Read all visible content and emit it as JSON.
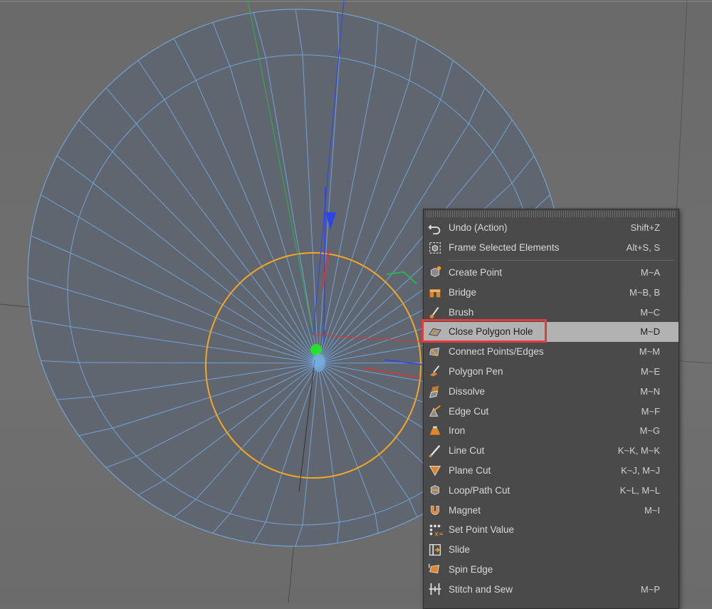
{
  "viewport": {
    "colors": {
      "mesh_fill": "#5f6670",
      "wire": "#6fa3d8",
      "selection": "#f5a623",
      "axis_x": "#e0342c",
      "axis_y": "#2bb34a",
      "axis_z": "#2f44e8",
      "pivot": "#27e02b"
    }
  },
  "context_menu": {
    "items": [
      {
        "label": "Undo (Action)",
        "shortcut": "Shift+Z",
        "icon": "undo-icon"
      },
      {
        "label": "Frame Selected Elements",
        "shortcut": "Alt+S, S",
        "icon": "frame-selected-icon"
      },
      {
        "label": "Create Point",
        "shortcut": "M~A",
        "icon": "create-point-icon"
      },
      {
        "label": "Bridge",
        "shortcut": "M~B, B",
        "icon": "bridge-icon"
      },
      {
        "label": "Brush",
        "shortcut": "M~C",
        "icon": "brush-icon"
      },
      {
        "label": "Close Polygon Hole",
        "shortcut": "M~D",
        "icon": "close-polygon-hole-icon"
      },
      {
        "label": "Connect Points/Edges",
        "shortcut": "M~M",
        "icon": "connect-points-icon"
      },
      {
        "label": "Polygon Pen",
        "shortcut": "M~E",
        "icon": "polygon-pen-icon"
      },
      {
        "label": "Dissolve",
        "shortcut": "M~N",
        "icon": "dissolve-icon"
      },
      {
        "label": "Edge Cut",
        "shortcut": "M~F",
        "icon": "edge-cut-icon"
      },
      {
        "label": "Iron",
        "shortcut": "M~G",
        "icon": "iron-icon"
      },
      {
        "label": "Line Cut",
        "shortcut": "K~K, M~K",
        "icon": "line-cut-icon"
      },
      {
        "label": "Plane Cut",
        "shortcut": "K~J, M~J",
        "icon": "plane-cut-icon"
      },
      {
        "label": "Loop/Path Cut",
        "shortcut": "K~L, M~L",
        "icon": "loop-path-cut-icon"
      },
      {
        "label": "Magnet",
        "shortcut": "M~I",
        "icon": "magnet-icon"
      },
      {
        "label": "Set Point Value",
        "shortcut": "",
        "icon": "set-point-value-icon"
      },
      {
        "label": "Slide",
        "shortcut": "",
        "icon": "slide-icon"
      },
      {
        "label": "Spin Edge",
        "shortcut": "",
        "icon": "spin-edge-icon"
      },
      {
        "label": "Stitch and Sew",
        "shortcut": "M~P",
        "icon": "stitch-and-sew-icon"
      }
    ]
  }
}
